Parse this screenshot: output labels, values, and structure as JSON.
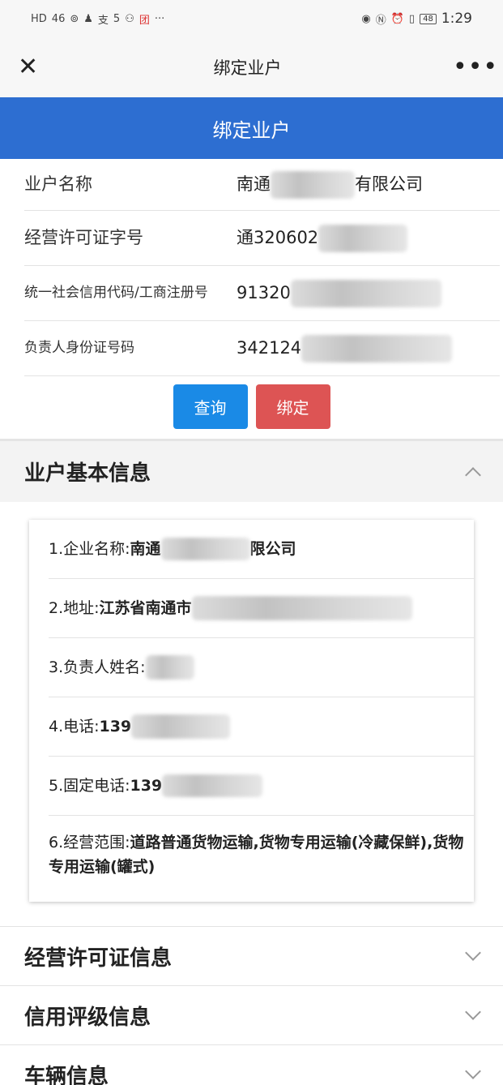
{
  "status_bar": {
    "left": [
      "HD",
      "46",
      "⊚",
      "♟",
      "支",
      "5",
      "⚇",
      "团",
      "···"
    ],
    "battery": "48",
    "time": "1:29"
  },
  "nav": {
    "title": "绑定业户"
  },
  "header": {
    "title": "绑定业户"
  },
  "form": {
    "rows": [
      {
        "label": "业户名称",
        "value": "南通",
        "value_suffix": "有限公司"
      },
      {
        "label": "经营许可证字号",
        "value": "通320602"
      },
      {
        "label": "统一社会信用代码/工商注册号",
        "value": "91320"
      },
      {
        "label": "负责人身份证号码",
        "value": "342124"
      }
    ],
    "query_button": "查询",
    "bind_button": "绑定"
  },
  "basic_info": {
    "title": "业户基本信息",
    "items": [
      {
        "prefix": "1.企业名称:",
        "bold": "南通",
        "bold_suffix": "限公司"
      },
      {
        "prefix": "2.地址:",
        "bold": "江苏省南通市"
      },
      {
        "prefix": "3.负责人姓名:",
        "bold": ""
      },
      {
        "prefix": "4.电话:",
        "bold": "139"
      },
      {
        "prefix": "5.固定电话:",
        "bold": "139"
      },
      {
        "prefix": "6.经营范围:",
        "bold": "道路普通货物运输,货物专用运输(冷藏保鲜),货物专用运输(罐式)"
      }
    ]
  },
  "sections": [
    {
      "title": "经营许可证信息"
    },
    {
      "title": "信用评级信息"
    },
    {
      "title": "车辆信息"
    }
  ],
  "colors": {
    "header_blue": "#2d6ed1",
    "query_blue": "#1a8ae6",
    "bind_red": "#dd5454"
  }
}
